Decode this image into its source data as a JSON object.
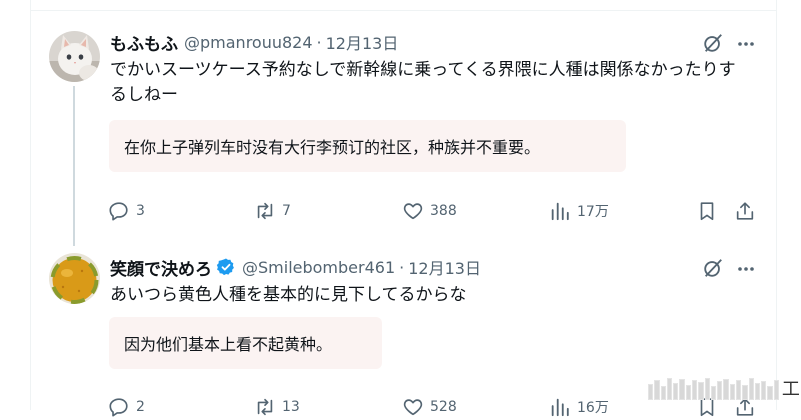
{
  "colors": {
    "accent": "#1d9bf0",
    "muted": "#536471",
    "border": "#eff3f4",
    "translation_bg": "#fbf3f2"
  },
  "tweets": [
    {
      "display_name": "もふもふ",
      "handle": "@pmanrouu824",
      "separator": "·",
      "time": "12月13日",
      "verified": false,
      "avatar_icon": "kitten-avatar",
      "text": "でかいスーツケース予約なしで新幹線に乗ってくる界隈に人種は関係なかったりするしねー",
      "translation": "在你上子弹列车时没有大行李预订的社区，种族并不重要。",
      "counts": {
        "replies": "3",
        "retweets": "7",
        "likes": "388",
        "views": "17万"
      }
    },
    {
      "display_name": "笑顔で決めろ",
      "handle": "@Smilebomber461",
      "separator": "·",
      "time": "12月13日",
      "verified": true,
      "avatar_icon": "orange-avatar",
      "text": "あいつら黄色人種を基本的に見下してるからな",
      "translation": "因为他们基本上看不起黄种。",
      "counts": {
        "replies": "2",
        "retweets": "13",
        "likes": "528",
        "views": "16万"
      }
    }
  ],
  "watermark": {
    "label": "工"
  }
}
